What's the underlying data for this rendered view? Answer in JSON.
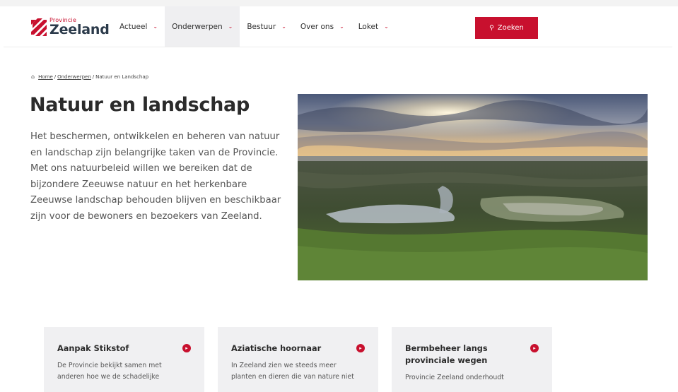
{
  "header": {
    "logo_small": "Provincie",
    "logo_big": "Zeeland",
    "nav": [
      {
        "label": "Actueel",
        "active": false
      },
      {
        "label": "Onderwerpen",
        "active": true
      },
      {
        "label": "Bestuur",
        "active": false
      },
      {
        "label": "Over ons",
        "active": false
      },
      {
        "label": "Loket",
        "active": false
      }
    ],
    "search_label": "Zoeken"
  },
  "breadcrumb": {
    "home": "Home",
    "sep1": "/",
    "item1": "Onderwerpen",
    "sep2": "/",
    "current": "Natuur en Landschap"
  },
  "main": {
    "title": "Natuur en landschap",
    "intro": "Het beschermen, ontwikkelen en beheren van natuur en landschap zijn belangrijke taken van de Provincie. Met ons natuurbeleid willen we bereiken dat de bijzondere Zeeuwse natuur en het herkenbare Zeeuwse landschap behouden blijven en beschikbaar zijn voor de bewoners en bezoekers van Zeeland."
  },
  "cards": [
    {
      "title": "Aanpak Stikstof",
      "text": "De Provincie bekijkt samen met anderen hoe we de schadelijke"
    },
    {
      "title": "Aziatische hoornaar",
      "text": "In Zeeland zien we steeds meer planten en dieren die van nature niet"
    },
    {
      "title": "Bermbeheer langs provinciale wegen",
      "text": "Provincie Zeeland onderhoudt"
    }
  ],
  "colors": {
    "accent": "#c8102e",
    "nav_active_bg": "#efeff1",
    "card_bg": "#f0f0f2"
  }
}
